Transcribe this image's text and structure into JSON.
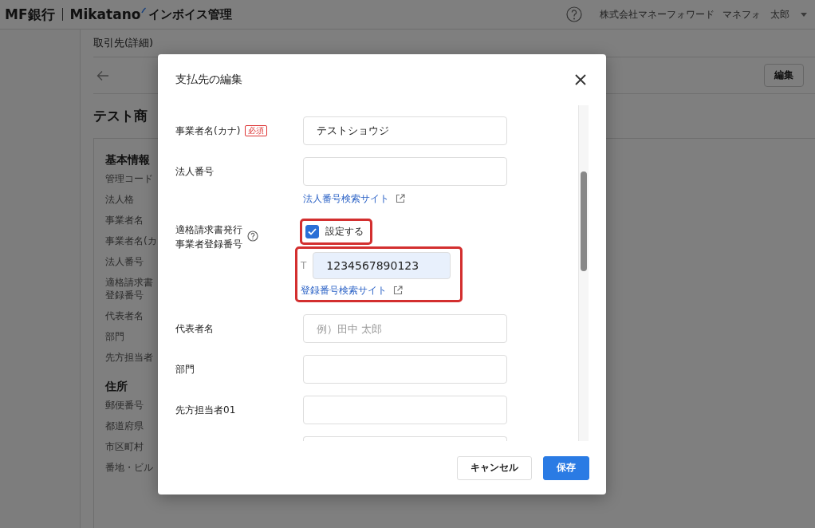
{
  "app_header": {
    "logo_bank": "MF銀行",
    "logo_product": "Mikatano",
    "logo_suffix": "インボイス管理",
    "company": "株式会社マネーフォワード",
    "user": "マネフォ 太郎"
  },
  "page": {
    "breadcrumb": "取引先(詳細)",
    "edit_button": "編集",
    "title": "テスト商",
    "sections": [
      {
        "heading": "基本情報",
        "labels": [
          "管理コード",
          "法人格",
          "事業者名",
          "事業者名(カ",
          "法人番号",
          [
            "適格請求書",
            "登録番号"
          ],
          "代表者名",
          "部門",
          "先方担当者"
        ]
      },
      {
        "heading": "住所",
        "labels": [
          "郵便番号",
          "都道府県",
          "市区町村",
          "番地・ビル"
        ]
      }
    ]
  },
  "dialog": {
    "title": "支払先の編集",
    "fields": [
      {
        "kind": "text",
        "label": "事業者名(カナ)",
        "required_badge": "必須",
        "value": "テストショウジ"
      },
      {
        "kind": "text",
        "label": "法人番号",
        "link": "法人番号検索サイト"
      },
      {
        "kind": "registration",
        "label_lines": [
          "適格請求書発行",
          "事業者登録番号"
        ],
        "checkbox": {
          "label": "設定する",
          "checked": true,
          "highlighted": true
        },
        "prefix": "T",
        "value": "1234567890123",
        "link": "登録番号検索サイト",
        "highlighted": true
      },
      {
        "kind": "text",
        "label": "代表者名",
        "placeholder": "例）田中 太郎"
      },
      {
        "kind": "text",
        "label": "部門"
      },
      {
        "kind": "text",
        "label": "先方担当者01"
      },
      {
        "kind": "text"
      }
    ],
    "buttons": [
      {
        "label": "キャンセル",
        "kind": "secondary"
      },
      {
        "label": "保存",
        "kind": "primary"
      }
    ]
  }
}
